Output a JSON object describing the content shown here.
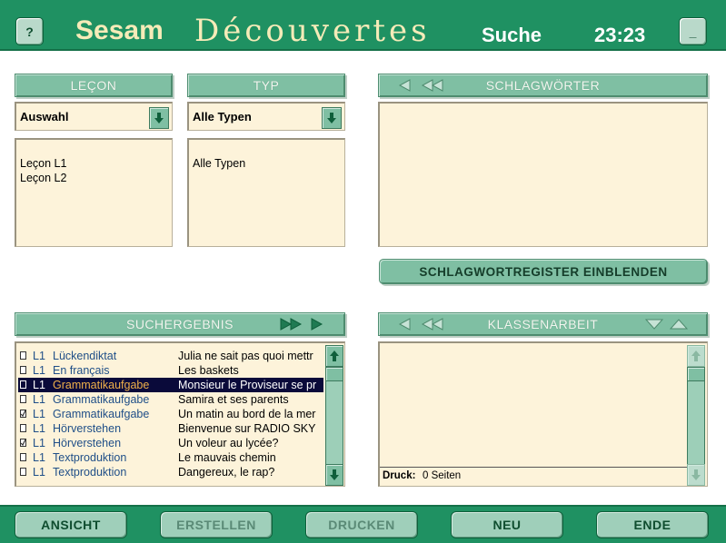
{
  "header": {
    "help_label": "?",
    "app_name": "Sesam",
    "app_subtitle": "Découvertes",
    "mode": "Suche",
    "clock": "23:23",
    "minimize_label": "_"
  },
  "lecon": {
    "title": "LEÇON",
    "selected": "Auswahl",
    "items": [
      "Leçon L1",
      "Leçon L2"
    ]
  },
  "typ": {
    "title": "TYP",
    "selected": "Alle Typen",
    "items": [
      "Alle Typen"
    ]
  },
  "schlagwoerter": {
    "title": "SCHLAGWÖRTER",
    "register_button": "SCHLAGWORTREGISTER EINBLENDEN"
  },
  "suchergebnis": {
    "title": "SUCHERGEBNIS",
    "rows": [
      {
        "level": "L1",
        "type": "Lückendiktat",
        "title": "Julia ne sait pas quoi mettr",
        "checked": false,
        "selected": false
      },
      {
        "level": "L1",
        "type": "En français",
        "title": "Les baskets",
        "checked": false,
        "selected": false
      },
      {
        "level": "L1",
        "type": "Grammatikaufgabe",
        "title": "Monsieur le Proviseur se pr",
        "checked": false,
        "selected": true
      },
      {
        "level": "L1",
        "type": "Grammatikaufgabe",
        "title": "Samira et ses parents",
        "checked": false,
        "selected": false
      },
      {
        "level": "L1",
        "type": "Grammatikaufgabe",
        "title": "Un matin au bord de la mer",
        "checked": true,
        "selected": false
      },
      {
        "level": "L1",
        "type": "Hörverstehen",
        "title": "Bienvenue sur RADIO SKY",
        "checked": false,
        "selected": false
      },
      {
        "level": "L1",
        "type": "Hörverstehen",
        "title": "Un voleur au lycée?",
        "checked": true,
        "selected": false
      },
      {
        "level": "L1",
        "type": "Textproduktion",
        "title": "Le mauvais chemin",
        "checked": false,
        "selected": false
      },
      {
        "level": "L1",
        "type": "Textproduktion",
        "title": "Dangereux, le rap?",
        "checked": false,
        "selected": false
      }
    ]
  },
  "klassenarbeit": {
    "title": "KLASSENARBEIT",
    "druck_label": "Druck:",
    "druck_value": "0 Seiten"
  },
  "footer": {
    "ansicht": "ANSICHT",
    "erstellen": "ERSTELLEN",
    "drucken": "DRUCKEN",
    "neu": "NEU",
    "ende": "ENDE"
  },
  "colors": {
    "bar_green": "#1f9162",
    "header_green": "#7fbfa3",
    "panel_cream": "#fdf3da",
    "title_cream": "#f5ebb8",
    "selection": "#0a0a3a"
  }
}
